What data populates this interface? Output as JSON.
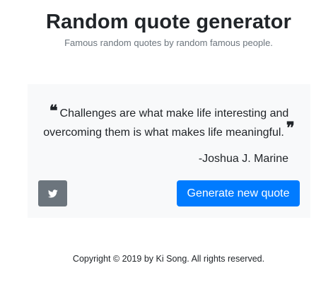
{
  "header": {
    "title": "Random quote generator",
    "subtitle": "Famous random quotes by random famous people."
  },
  "quote_card": {
    "open_mark": "❝",
    "text": "Challenges are what make life interesting and overcoming them is what makes life meaningful.",
    "close_mark": "❞",
    "author": "-Joshua J. Marine",
    "tweet_icon": "twitter-icon",
    "generate_label": "Generate new quote"
  },
  "footer": {
    "copyright": "Copyright © 2019 by Ki Song. All rights reserved."
  },
  "colors": {
    "primary": "#007bff",
    "secondary": "#6c757d",
    "card_background": "#f8f9fa",
    "subtitle_text": "#6c757d"
  }
}
